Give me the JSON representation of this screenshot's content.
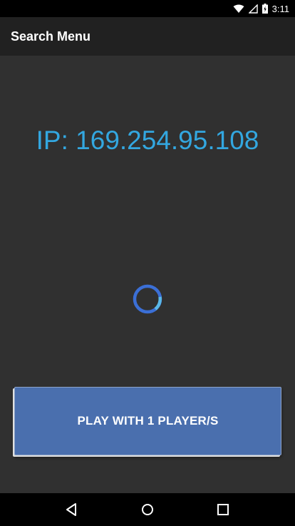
{
  "status_bar": {
    "time": "3:11",
    "icons": [
      "wifi-icon",
      "signal-icon",
      "battery-charging-icon"
    ]
  },
  "app_bar": {
    "title": "Search Menu"
  },
  "main": {
    "ip_label": "IP: 169.254.95.108",
    "spinner": "loading-spinner",
    "play_button_label": "PLAY WITH 1 PLAYER/S"
  },
  "nav_bar": {
    "icons": [
      "back-icon",
      "home-icon",
      "recents-icon"
    ]
  },
  "colors": {
    "ip_text": "#33a7e0",
    "button": "#4a6fae",
    "background": "#303030",
    "app_bar": "#212121",
    "spinner_primary": "#3b6fd6",
    "spinner_accent": "#5ab8e8"
  }
}
